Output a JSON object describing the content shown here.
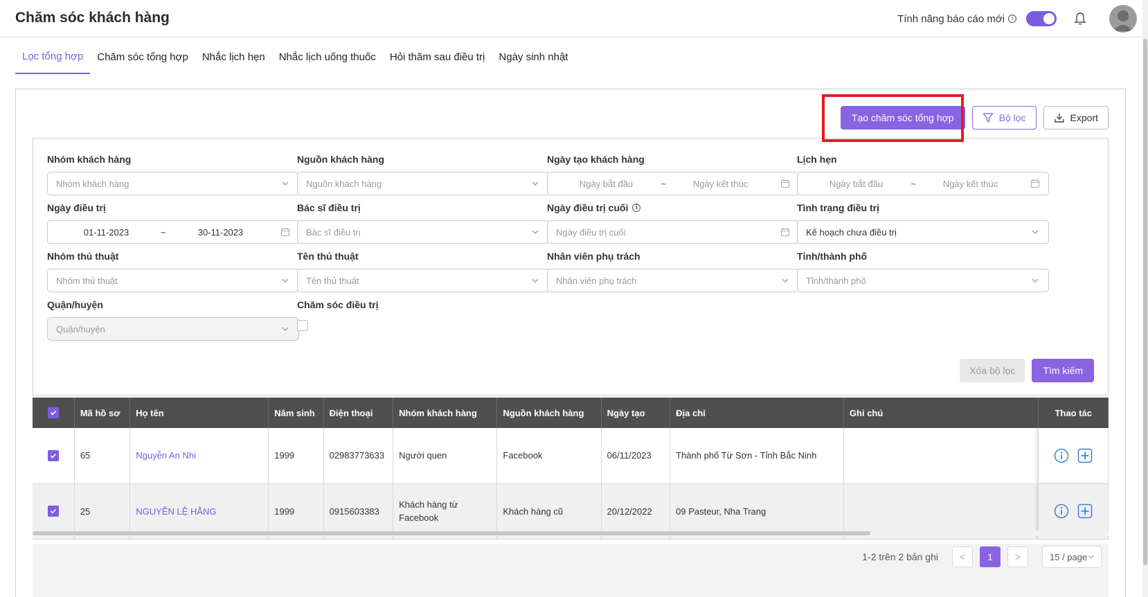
{
  "header": {
    "title": "Chăm sóc khách hàng",
    "report_toggle_label": "Tính năng báo cáo mới"
  },
  "tabs": [
    {
      "label": "Lọc tổng hợp"
    },
    {
      "label": "Chăm sóc tổng hợp"
    },
    {
      "label": "Nhắc lịch hẹn"
    },
    {
      "label": "Nhắc lịch uống thuốc"
    },
    {
      "label": "Hỏi thăm sau điều trị"
    },
    {
      "label": "Ngày sinh nhật"
    }
  ],
  "actions": {
    "create_label": "Tạo chăm sóc tổng hợp",
    "filter_label": "Bộ lọc",
    "export_label": "Export"
  },
  "filters": {
    "customer_group": {
      "label": "Nhóm khách hàng",
      "placeholder": "Nhóm khách hàng"
    },
    "customer_source": {
      "label": "Nguồn khách hàng",
      "placeholder": "Nguồn khách hàng"
    },
    "created_date": {
      "label": "Ngày tạo khách hàng",
      "start": "Ngày bắt đầu",
      "end": "Ngày kết thúc"
    },
    "appointment": {
      "label": "Lịch hẹn",
      "start": "Ngày bắt đầu",
      "end": "Ngày kết thúc"
    },
    "treatment_date": {
      "label": "Ngày điều trị",
      "start": "01-11-2023",
      "end": "30-11-2023"
    },
    "doctor": {
      "label": "Bác sĩ điều trị",
      "placeholder": "Bác sĩ điều trị"
    },
    "last_treatment": {
      "label": "Ngày điều trị cuối",
      "placeholder": "Ngày điều trị cuối"
    },
    "treatment_status": {
      "label": "Tình trạng điều trị",
      "value": "Kế hoạch chưa điều trị"
    },
    "procedure_group": {
      "label": "Nhóm thủ thuật",
      "placeholder": "Nhóm thủ thuật"
    },
    "procedure_name": {
      "label": "Tên thủ thuật",
      "placeholder": "Tên thủ thuật"
    },
    "staff": {
      "label": "Nhân viên phụ trách",
      "placeholder": "Nhân viên phụ trách"
    },
    "province": {
      "label": "Tỉnh/thành phố",
      "placeholder": "Tỉnh/thành phố"
    },
    "district": {
      "label": "Quận/huyện",
      "placeholder": "Quận/huyện"
    },
    "care_treatment": {
      "label": "Chăm sóc điều trị"
    },
    "clear_label": "Xóa bộ lọc",
    "search_label": "Tìm kiếm"
  },
  "table": {
    "columns": [
      "Mã hồ sơ",
      "Họ tên",
      "Năm sinh",
      "Điện thoại",
      "Nhóm khách hàng",
      "Nguồn khách hàng",
      "Ngày tạo",
      "Địa chỉ",
      "Ghi chú",
      "Thao tác"
    ],
    "rows": [
      {
        "id": "65",
        "name": "Nguyễn An Nhi",
        "birth_year": "1999",
        "phone": "02983773633",
        "group": "Người quen",
        "source": "Facebook",
        "created": "06/11/2023",
        "address": "Thành phố Từ Sơn - Tỉnh Bắc Ninh",
        "note": ""
      },
      {
        "id": "25",
        "name": "NGUYỄN LỆ HẰNG",
        "birth_year": "1999",
        "phone": "0915603383",
        "group": "Khách hàng từ Facebook",
        "source": "Khách hàng cũ",
        "created": "20/12/2022",
        "address": "09 Pasteur, Nha Trang",
        "note": ""
      }
    ]
  },
  "pagination": {
    "info": "1-2 trên 2 bản ghi",
    "prev": "<",
    "current": "1",
    "next": ">",
    "page_size": "15 / page"
  },
  "colors": {
    "accent": "#8a63e3",
    "highlight": "#e31b23",
    "table_header": "#4f4f4f"
  }
}
